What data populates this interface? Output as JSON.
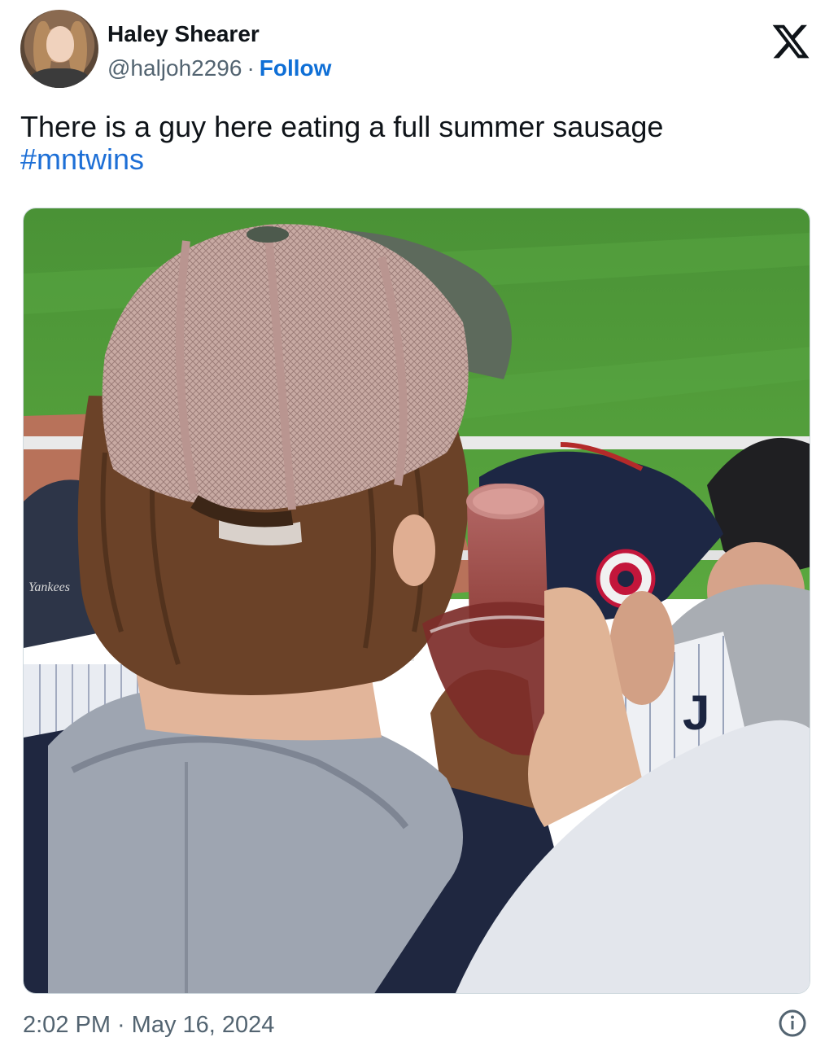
{
  "author": {
    "name": "Haley Shearer",
    "handle": "@haljoh2296",
    "separator": "·",
    "follow_label": "Follow"
  },
  "tweet": {
    "text": "There is a guy here eating a full summer sausage",
    "hashtag": "#mntwins"
  },
  "media": {
    "description_icon": "photo",
    "hat_text": "Yankees"
  },
  "meta": {
    "time": "2:02 PM",
    "separator": "·",
    "date": "May 16, 2024"
  },
  "icons": {
    "platform": "x-logo-icon",
    "info": "info-icon"
  },
  "colors": {
    "link": "#1d6fd6",
    "secondary_text": "#536471",
    "field_green": "#4f9a3a"
  }
}
